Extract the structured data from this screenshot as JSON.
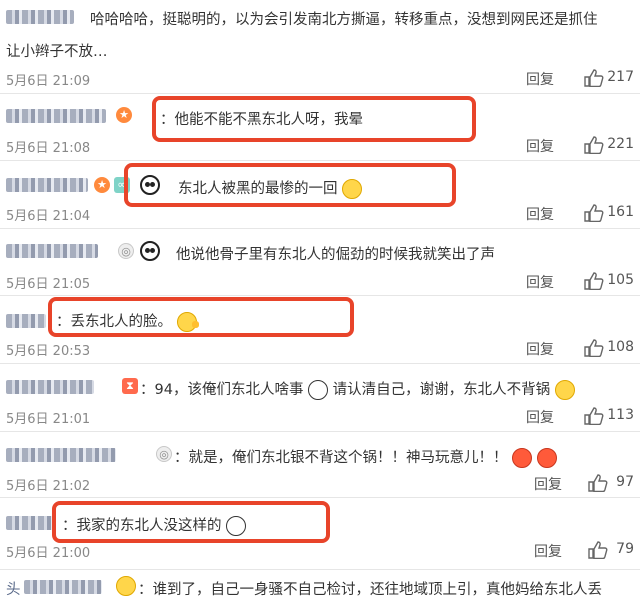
{
  "comments": [
    {
      "text_line1": "哈哈哈哈，挺聪明的，以为会引发南北方撕逼，转移重点，没想到网民还是抓住",
      "text_line2": "让小辫子不放…",
      "time": "5月6日 21:09",
      "reply": "回复",
      "likes": "217"
    },
    {
      "text": "：他能不能不黑东北人呀，我晕",
      "time": "5月6日 21:08",
      "reply": "回复",
      "likes": "221"
    },
    {
      "text": "东北人被黑的最惨的一回",
      "time": "5月6日 21:04",
      "reply": "回复",
      "likes": "161"
    },
    {
      "text": "他说他骨子里有东北人的倔劲的时候我就笑出了声",
      "time": "5月6日 21:05",
      "reply": "回复",
      "likes": "105"
    },
    {
      "text": "：丢东北人的脸。",
      "time": "5月6日 20:53",
      "reply": "回复",
      "likes": "108"
    },
    {
      "text_a": "：94，该俺们东北人啥事",
      "text_b": "请认清自己，谢谢，东北人不背锅",
      "time": "5月6日 21:01",
      "reply": "回复",
      "likes": "113"
    },
    {
      "text": "：就是，俺们东北银不背这个锅！！神马玩意儿！！",
      "time": "5月6日 21:02",
      "reply": "回复",
      "likes": "97"
    },
    {
      "text": "：我家的东北人没这样的",
      "time": "5月6日 21:00",
      "reply": "回复",
      "likes": "79"
    },
    {
      "prefix": "头",
      "text": "：谁到了，自己一身骚不自己检讨，还往地域顶上引，真他妈给东北人丢"
    }
  ],
  "colors": {
    "highlight": "#e8442a",
    "meta": "#888888",
    "text": "#333333"
  }
}
